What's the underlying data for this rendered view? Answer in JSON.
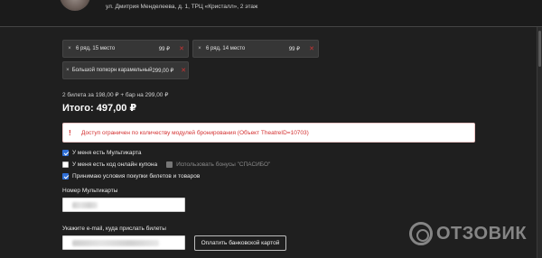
{
  "header": {
    "address": "ул. Дмитрия Менделеева, д. 1, ТРЦ «Кристалл», 2 этаж"
  },
  "cart": {
    "items": [
      {
        "label": "6 ряд, 15 место",
        "price": "99 ₽"
      },
      {
        "label": "6 ряд, 14 место",
        "price": "99 ₽"
      },
      {
        "label": "Большой попкорн карамельный",
        "price": "299,00 ₽"
      }
    ],
    "remove_glyph": "×",
    "delete_glyph": "✕"
  },
  "summary": {
    "line": "2 билета за 198,00 ₽ + бар на 299,00 ₽",
    "total": "Итого: 497,00 ₽"
  },
  "alert": {
    "icon": "!",
    "text": "Доступ ограничен по количеству модулей бронирования (Объект TheatreID=10703)"
  },
  "options": {
    "multicard": {
      "label": "У меня есть Мультикарта",
      "checked": true
    },
    "coupon": {
      "label": "У меня есть код онлайн купона",
      "checked": false
    },
    "spasibo": {
      "label": "Использовать бонусы \"СПАСИБО\"",
      "checked": false
    },
    "terms": {
      "label": "Принимаю условия покупки билетов и товаров",
      "checked": true
    }
  },
  "form": {
    "multicard_label": "Номер Мультикарты",
    "email_label": "Укажите e-mail, куда прислать билеты",
    "pay_button": "Оплатить банковской картой"
  },
  "watermark": {
    "text": "ОТЗОВИК"
  }
}
